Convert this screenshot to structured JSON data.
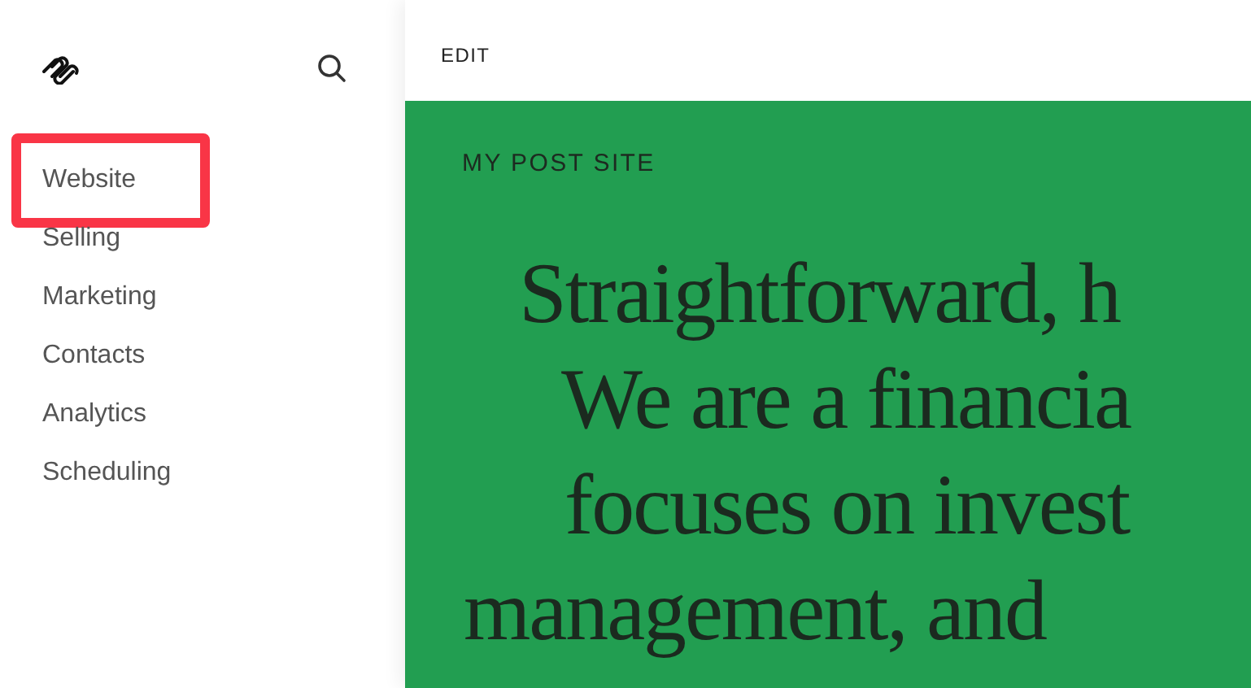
{
  "sidebar": {
    "items": [
      {
        "label": "Website",
        "selected": true
      },
      {
        "label": "Selling",
        "selected": false
      },
      {
        "label": "Marketing",
        "selected": false
      },
      {
        "label": "Contacts",
        "selected": false
      },
      {
        "label": "Analytics",
        "selected": false
      },
      {
        "label": "Scheduling",
        "selected": false
      }
    ]
  },
  "toolbar": {
    "edit_label": "EDIT"
  },
  "preview": {
    "site_title": "MY POST SITE",
    "heading_lines": [
      "Straightforward, h",
      "We are a financia",
      "focuses on invest",
      "management, and"
    ]
  }
}
